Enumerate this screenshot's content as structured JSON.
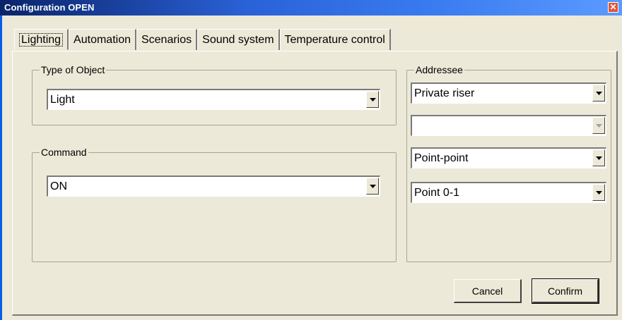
{
  "window": {
    "title": "Configuration OPEN",
    "close_icon": "close-icon"
  },
  "tabs": [
    {
      "label": "Lighting",
      "active": true
    },
    {
      "label": "Automation",
      "active": false
    },
    {
      "label": "Scenarios",
      "active": false
    },
    {
      "label": "Sound system",
      "active": false
    },
    {
      "label": "Temperature control",
      "active": false
    }
  ],
  "type_of_object": {
    "label": "Type of Object",
    "value": "Light"
  },
  "command": {
    "label": "Command",
    "value": "ON"
  },
  "addressee": {
    "label": "Addressee",
    "riser": "Private riser",
    "secondary": "",
    "mode": "Point-point",
    "point": "Point 0-1"
  },
  "buttons": {
    "cancel": "Cancel",
    "confirm": "Confirm"
  }
}
